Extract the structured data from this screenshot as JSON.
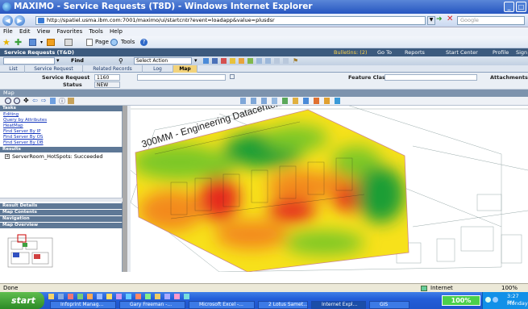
{
  "window": {
    "title": "MAXIMO - Service Requests (T8D) - Windows Internet Explorer"
  },
  "browser": {
    "url": "http://spatiel.usma.ibm.com:7001/maximo/ui/startcntr?event=loadapp&value=plusdsr",
    "search_placeholder": "Google",
    "menu": [
      "File",
      "Edit",
      "View",
      "Favorites",
      "Tools",
      "Help"
    ],
    "toolbar": {
      "page": "Page",
      "tools": "Tools"
    }
  },
  "app": {
    "title": "Service Requests (T&D)",
    "header_links": [
      "Bulletins: (2)",
      "Go To",
      "Reports",
      "Start Center",
      "Profile",
      "Sign Out"
    ],
    "find_label": "Find",
    "select_action": "Select Action",
    "tabs": [
      "List",
      "Service Request",
      "Related Records",
      "Log",
      "Map"
    ],
    "active_tab": "Map"
  },
  "form": {
    "service_request_label": "Service Request",
    "service_request_value": "1160",
    "status_label": "Status",
    "status_value": "NEW",
    "feature_class_label": "Feature Class",
    "attachments_label": "Attachments"
  },
  "map": {
    "section_label": "Map",
    "tasks_header": "Tasks",
    "task_links": [
      "Editing",
      "Query by Attributes",
      "HeatMap",
      "Find Server By IP",
      "Find Server By OS",
      "Find Server By DB"
    ],
    "results_header": "Results",
    "result_item": "ServerRoom_HotSpots: Succeeded",
    "panel_headers": [
      "Result Details",
      "Map Contents",
      "Navigation",
      "Map Overview"
    ],
    "map_title": "300MM - Engineering Datacenter",
    "heat_colors": {
      "hot": "#e52a1f",
      "warm": "#f38a1c",
      "mid": "#f7e11b",
      "cool": "#7dc826",
      "cold": "#1f9e34"
    }
  },
  "status": {
    "left": "Done",
    "zone": "Internet",
    "zoom": "100%"
  },
  "taskbar": {
    "start": "start",
    "tasks": [
      "Infoprint Manag...",
      "Gary Freeman -...",
      "Microsoft Excel -...",
      "2 Lotus Samet...",
      "Internet Expl...",
      "GIS"
    ],
    "active_task": "Internet Expl...",
    "battery": "100%",
    "clock": "3:27 PM",
    "day": "Monday"
  }
}
